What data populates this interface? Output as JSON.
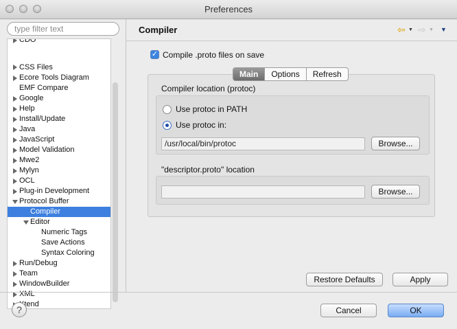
{
  "window": {
    "title": "Preferences"
  },
  "sidebar": {
    "filter_placeholder": "type filter text",
    "items": [
      {
        "label": "CDO"
      },
      {
        "label": "CSS Files"
      },
      {
        "label": "Ecore Tools Diagram"
      },
      {
        "label": "EMF Compare"
      },
      {
        "label": "Google"
      },
      {
        "label": "Help"
      },
      {
        "label": "Install/Update"
      },
      {
        "label": "Java"
      },
      {
        "label": "JavaScript"
      },
      {
        "label": "Model Validation"
      },
      {
        "label": "Mwe2"
      },
      {
        "label": "Mylyn"
      },
      {
        "label": "OCL"
      },
      {
        "label": "Plug-in Development"
      },
      {
        "label": "Protocol Buffer"
      },
      {
        "label": "Compiler",
        "selected": true
      },
      {
        "label": "Editor"
      },
      {
        "label": "Numeric Tags"
      },
      {
        "label": "Save Actions"
      },
      {
        "label": "Syntax Coloring"
      },
      {
        "label": "Run/Debug"
      },
      {
        "label": "Team"
      },
      {
        "label": "WindowBuilder"
      },
      {
        "label": "XML"
      },
      {
        "label": "Xtend"
      }
    ]
  },
  "main": {
    "title": "Compiler",
    "compile_on_save_label": "Compile .proto files on save",
    "compile_on_save_checked": true,
    "tabs": [
      {
        "label": "Main",
        "active": true
      },
      {
        "label": "Options"
      },
      {
        "label": "Refresh"
      }
    ],
    "compiler_location": {
      "group_label": "Compiler location (protoc)",
      "radio_path_label": "Use protoc in PATH",
      "radio_custom_label": "Use protoc in:",
      "selected": "custom",
      "path_value": "/usr/local/bin/protoc",
      "browse_label": "Browse..."
    },
    "descriptor_location": {
      "group_label": "\"descriptor.proto\" location",
      "path_value": "",
      "browse_label": "Browse..."
    },
    "restore_defaults_label": "Restore Defaults",
    "apply_label": "Apply"
  },
  "footer": {
    "help_icon": "?",
    "cancel_label": "Cancel",
    "ok_label": "OK"
  },
  "icons": {
    "back_icon": "⇦",
    "forward_icon": "⇨",
    "menu_icon": "▼"
  },
  "colors": {
    "selection": "#3d80df",
    "ok_button": "#79acf3"
  }
}
